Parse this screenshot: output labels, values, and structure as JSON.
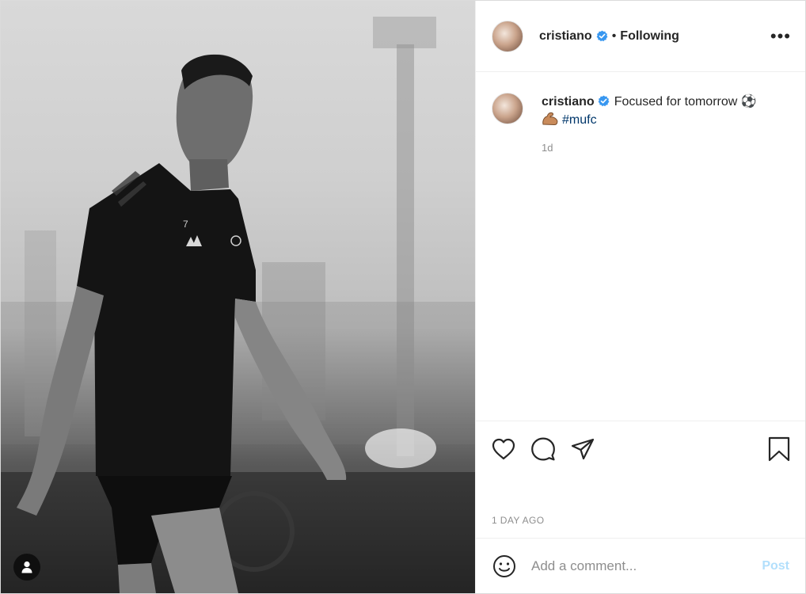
{
  "post": {
    "author": {
      "username": "cristiano",
      "follow_status": "Following",
      "separator": "•"
    },
    "caption": {
      "username": "cristiano",
      "text": "Focused for tomorrow ⚽",
      "hashtag": "#mufc",
      "time": "1d"
    },
    "timestamp": "1 DAY AGO",
    "comment_box": {
      "placeholder": "Add a comment...",
      "post_label": "Post"
    },
    "more_label": "•••"
  },
  "icons": {
    "verified": "verified-badge-icon",
    "like": "heart-icon",
    "comment": "comment-bubble-icon",
    "share": "paper-plane-icon",
    "save": "bookmark-icon",
    "emoji": "smiley-icon",
    "tag": "user-tag-icon",
    "flex": "flexed-biceps-icon"
  },
  "colors": {
    "verified": "#3897f0",
    "hashtag": "#00376b",
    "post_disabled": "#b2dffc",
    "muted": "#8e8e8e"
  }
}
